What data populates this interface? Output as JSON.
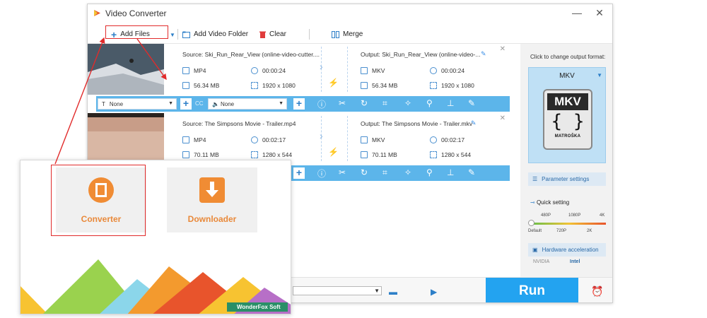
{
  "window": {
    "title": "Video Converter",
    "minimize": "—",
    "close": "✕"
  },
  "toolbar": {
    "add_files": "Add Files",
    "add_video_folder": "Add Video Folder",
    "clear": "Clear",
    "merge": "Merge"
  },
  "files": [
    {
      "source": "Source: Ski_Run_Rear_View (online-video-cutter....",
      "output": "Output: Ski_Run_Rear_View (online-video-...",
      "src_format": "MP4",
      "src_duration": "00:00:24",
      "src_size": "56.34 MB",
      "src_resolution": "1920 x 1080",
      "out_format": "MKV",
      "out_duration": "00:00:24",
      "out_size": "56.34 MB",
      "out_resolution": "1920 x 1080"
    },
    {
      "source": "Source: The Simpsons Movie - Trailer.mp4",
      "output": "Output: The Simpsons Movie - Trailer.mkv",
      "src_format": "MP4",
      "src_duration": "00:02:17",
      "src_size": "70.11 MB",
      "src_resolution": "1280 x 544",
      "out_format": "MKV",
      "out_duration": "00:02:17",
      "out_size": "70.11 MB",
      "out_resolution": "1280 x 544"
    }
  ],
  "edit_bar": {
    "subtitle_value": "None",
    "audio_value": "None"
  },
  "right_panel": {
    "prompt": "Click to change output format:",
    "format": "MKV",
    "icon_top": "MKV",
    "icon_mid": "{ }",
    "icon_bottom": "MATROŠKA",
    "parameter_settings": "Parameter settings",
    "quick_setting": "Quick setting",
    "levels_top": [
      "480P",
      "1080P",
      "4K"
    ],
    "levels_bottom": [
      "Default",
      "720P",
      "2K"
    ],
    "hardware_acceleration": "Hardware acceleration",
    "nvidia": "NVIDIA",
    "intel": "Intel"
  },
  "bottom": {
    "run": "Run"
  },
  "overlay": {
    "converter": "Converter",
    "downloader": "Downloader",
    "brand": "WonderFox Soft"
  },
  "colors": {
    "accent": "#23a3f0",
    "edit_bar": "#5cb5ea",
    "highlight": "#e12b2b",
    "converter_orange": "#f08c34"
  }
}
